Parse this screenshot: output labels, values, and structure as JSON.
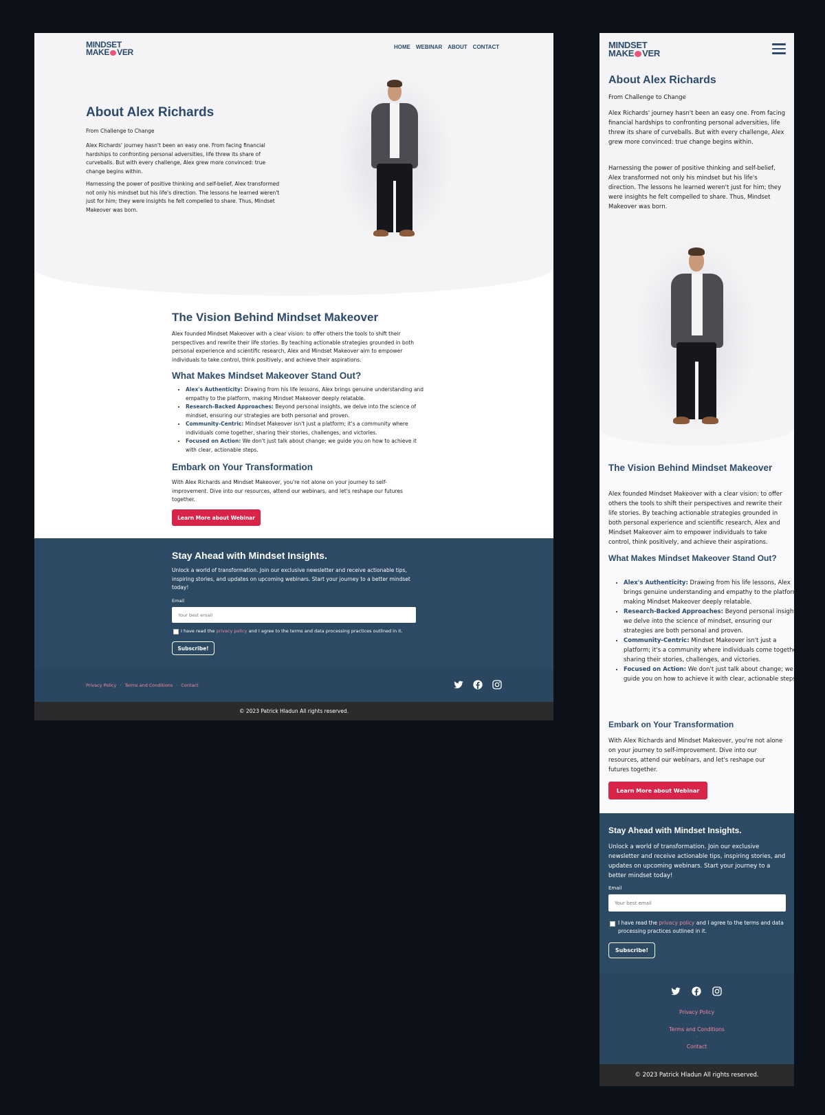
{
  "brand": {
    "line1": "MINDSET",
    "line2a": "MAKE",
    "line2b": "VER"
  },
  "nav": {
    "items": [
      "HOME",
      "WEBINAR",
      "ABOUT",
      "CONTACT"
    ]
  },
  "hero": {
    "title": "About Alex Richards",
    "subtitle": "From Challenge to Change",
    "p1": "Alex Richards' journey hasn't been an easy one. From facing financial hardships to confronting personal adversities, life threw its share of curveballs. But with every challenge, Alex grew more convinced: true change begins within.",
    "p2": "Harnessing the power of positive thinking and self-belief, Alex transformed not only his mindset but his life's direction. The lessons he learned weren't just for him; they were insights he felt compelled to share. Thus, Mindset Makeover was born."
  },
  "vision": {
    "title": "The Vision Behind Mindset Makeover",
    "text": "Alex founded Mindset Makeover with a clear vision: to offer others the tools to shift their perspectives and rewrite their life stories. By teaching actionable strategies grounded in both personal experience and scientific research, Alex and Mindset Makeover aim to empower individuals to take control, think positively, and achieve their aspirations."
  },
  "standout": {
    "title": "What Makes Mindset Makeover Stand Out?",
    "items": [
      {
        "lead": "Alex's Authenticity:",
        "text": " Drawing from his life lessons, Alex brings genuine understanding and empathy to the platform, making Mindset Makeover deeply relatable."
      },
      {
        "lead": "Research-Backed Approaches:",
        "text": " Beyond personal insights, we delve into the science of mindset, ensuring our strategies are both personal and proven."
      },
      {
        "lead": "Community-Centric:",
        "text": " Mindset Makeover isn't just a platform; it's a community where individuals come together, sharing their stories, challenges, and victories."
      },
      {
        "lead": "Focused on Action:",
        "text": " We don't just talk about change; we guide you on how to achieve it with clear, actionable steps."
      }
    ]
  },
  "embark": {
    "title": "Embark on Your Transformation",
    "text": "With Alex Richards and Mindset Makeover, you're not alone on your journey to self-improvement. Dive into our resources, attend our webinars, and let's reshape our futures together.",
    "button": "Learn More about Webinar"
  },
  "newsletter": {
    "title": "Stay Ahead with Mindset Insights.",
    "text": "Unlock a world of transformation. Join our exclusive newsletter and receive actionable tips, inspiring stories, and updates on upcoming webinars. Start your journey to a better mindset today!",
    "email_label": "Email",
    "email_placeholder": "Your best email",
    "consent_before": "I have read the ",
    "consent_link": "privacy policy",
    "consent_after": " and I agree to the terms and data processing practices outlined in it.",
    "button": "Subscribe!"
  },
  "footer": {
    "links": [
      "Privacy Policy",
      "Terms and Conditions",
      "Contact"
    ],
    "separator": "·",
    "social_icons": [
      "twitter-icon",
      "facebook-icon",
      "instagram-icon"
    ],
    "copyright": "© 2023 Patrick Hladun All rights reserved."
  },
  "colors": {
    "brand_navy": "#2c4a6b",
    "accent_red": "#d9244a",
    "link_pink": "#f08aa0",
    "newsletter_bg": "#2c4a63",
    "footer_dark": "#2b2b2d"
  }
}
